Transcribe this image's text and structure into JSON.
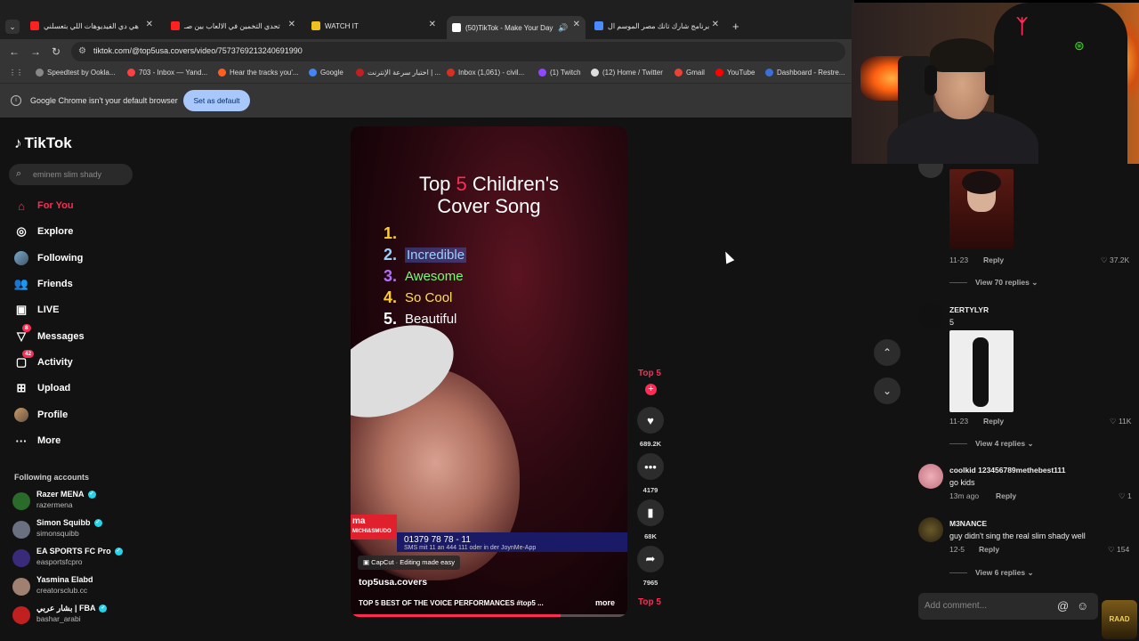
{
  "browser": {
    "tabs": [
      {
        "title": "هي دي الفيديوهات اللي بتعسلني",
        "fav_color": "#ff2020"
      },
      {
        "title": "تحدي التخمين في الالعاب بين صـ",
        "fav_color": "#ff2020"
      },
      {
        "title": "WATCH IT",
        "fav_color": "#f0c020"
      },
      {
        "title": "(50)TikTok - Make Your Day",
        "fav_color": "#ffffff"
      },
      {
        "title": "برنامج شارك تانك مصر الموسم ال",
        "fav_color": "#4a8cff"
      }
    ],
    "url": "tiktok.com/@top5usa.covers/video/7573769213240691990",
    "bookmarks": [
      {
        "label": "Speedtest by Ookla...",
        "color": "#888"
      },
      {
        "label": "703 - Inbox — Yand...",
        "color": "#ff4040"
      },
      {
        "label": "Hear the tracks you'...",
        "color": "#ff6020"
      },
      {
        "label": "Google",
        "color": "#4285f4"
      },
      {
        "label": "اختبار سرعة الإنترنت | ...",
        "color": "#c02020"
      },
      {
        "label": "Inbox (1,061) - civil...",
        "color": "#d83020"
      },
      {
        "label": "(1) Twitch",
        "color": "#9146ff"
      },
      {
        "label": "(12) Home / Twitter",
        "color": "#dddddd"
      },
      {
        "label": "Gmail",
        "color": "#ea4335"
      },
      {
        "label": "YouTube",
        "color": "#ff0000"
      },
      {
        "label": "Dashboard - Restre...",
        "color": "#3a6fd8"
      }
    ],
    "infobar": {
      "message": "Google Chrome isn't your default browser",
      "button": "Set as default"
    }
  },
  "tiktok": {
    "brand": "TikTok",
    "search_placeholder": "eminem slim shady",
    "nav": [
      {
        "label": "For You",
        "icon": "home-icon",
        "active": true
      },
      {
        "label": "Explore",
        "icon": "compass-icon"
      },
      {
        "label": "Following",
        "icon": "following-avatar-icon"
      },
      {
        "label": "Friends",
        "icon": "friends-icon"
      },
      {
        "label": "LIVE",
        "icon": "live-icon"
      },
      {
        "label": "Messages",
        "icon": "messages-icon",
        "badge": "8"
      },
      {
        "label": "Activity",
        "icon": "activity-icon",
        "badge": "42"
      },
      {
        "label": "Upload",
        "icon": "upload-icon"
      },
      {
        "label": "Profile",
        "icon": "profile-avatar-icon"
      },
      {
        "label": "More",
        "icon": "more-icon"
      }
    ],
    "following_title": "Following accounts",
    "following": [
      {
        "name": "Razer MENA",
        "handle": "razermena",
        "color": "#2a6a2a",
        "verified": true
      },
      {
        "name": "Simon Squibb",
        "handle": "simonsquibb",
        "color": "#6a7080",
        "verified": true
      },
      {
        "name": "EA SPORTS FC Pro",
        "handle": "easportsfcpro",
        "color": "#3a2a7a",
        "verified": true
      },
      {
        "name": "Yasmina Elabd",
        "handle": "creatorsclub.cc",
        "color": "#a08070",
        "verified": false
      },
      {
        "name": "بشار عربي | FBA",
        "handle": "bashar_arabi",
        "color": "#c02020",
        "verified": true
      }
    ]
  },
  "video": {
    "title_pre": "Top",
    "title_num": "5",
    "title_post": "Children's",
    "title_line2": "Cover Song",
    "list": [
      {
        "num": "1.",
        "text": "",
        "num_color": "#ffd020",
        "text_color": "#fff"
      },
      {
        "num": "2.",
        "text": "Incredible",
        "num_color": "#9ad0ff",
        "text_color": "#9ad0ff"
      },
      {
        "num": "3.",
        "text": "Awesome",
        "num_color": "#b070ff",
        "text_color": "#70ff70"
      },
      {
        "num": "4.",
        "text": "So Cool",
        "num_color": "#ffd020",
        "text_color": "#ffe050"
      },
      {
        "num": "5.",
        "text": "Beautiful",
        "num_color": "#ffffff",
        "text_color": "#ffffff"
      }
    ],
    "ticker_red": "ma",
    "ticker_red_sub": "MICHI&SMUDO",
    "ticker_blue": "01379 78 78 - 11",
    "ticker_blue_sub": "SMS mit 11 an 444 111 oder in der JoynMe-App",
    "capcut": "CapCut · Editing made easy",
    "author": "top5usa.covers",
    "description": "TOP 5 BEST OF THE VOICE PERFORMANCES #top5 ...",
    "more": "more",
    "progress": 0.76
  },
  "actions": {
    "tag": "Top 5",
    "likes": "689.2K",
    "comments": "4179",
    "saves": "68K",
    "shares": "7965",
    "bottom_tag": "Top 5"
  },
  "comments": {
    "c1": {
      "date": "11-23",
      "reply": "Reply",
      "likes": "37.2K",
      "view": "View 70 replies"
    },
    "c2": {
      "name": "ZERTYLYR",
      "text": "5",
      "date": "11-23",
      "reply": "Reply",
      "likes": "11K",
      "view": "View 4 replies"
    },
    "c3": {
      "name": "coolkid 123456789methebest111",
      "text": "go kids",
      "date": "13m ago",
      "reply": "Reply",
      "likes": "1"
    },
    "c4": {
      "name": "M3NANCE",
      "text": "guy didn't sing the real slim shady well",
      "date": "12-5",
      "reply": "Reply",
      "likes": "154",
      "view": "View 6 replies"
    },
    "add_placeholder": "Add comment..."
  },
  "overlay": {
    "badge": "RAAD"
  }
}
